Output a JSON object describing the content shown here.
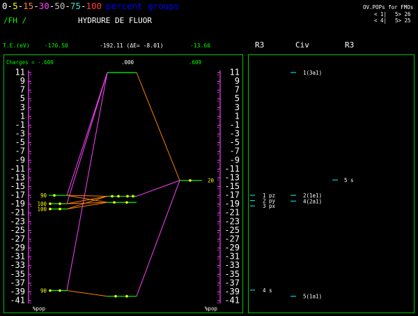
{
  "legend": {
    "scale": [
      {
        "text": "0",
        "color": "#ffffff"
      },
      {
        "text": "-",
        "color": "#ffffff"
      },
      {
        "text": "5",
        "color": "#ffff00"
      },
      {
        "text": "-",
        "color": "#ffffff"
      },
      {
        "text": "15",
        "color": "#ff8040"
      },
      {
        "text": "-",
        "color": "#ffffff"
      },
      {
        "text": "30",
        "color": "#ff40ff"
      },
      {
        "text": "-",
        "color": "#ffffff"
      },
      {
        "text": "50",
        "color": "#c0c0c0"
      },
      {
        "text": "-",
        "color": "#ffffff"
      },
      {
        "text": "75",
        "color": "#40e0d0"
      },
      {
        "text": "-",
        "color": "#ffffff"
      },
      {
        "text": "100",
        "color": "#ff4040"
      }
    ],
    "caption": "percent groups",
    "caption_color": "#0000ff"
  },
  "title": {
    "mol": "/FH /",
    "name": "HYDRURE DE FLUOR"
  },
  "ov_pops": {
    "heading": "OV.POPs for FMOs",
    "rows": [
      {
        "left": "<  1|",
        "right": "5> 26"
      },
      {
        "left": "<  4|",
        "right": "5> 25"
      }
    ]
  },
  "te": {
    "label": "T.E.(eV)",
    "left": "-170.50",
    "center": "-192.11  (ΔE= -8.01)",
    "right": "-13.60"
  },
  "charges": {
    "label": "Charges = -.609",
    "center": ".000",
    "right": ".609"
  },
  "axis": {
    "ticks": [
      "11",
      "9",
      "7",
      "5",
      "3",
      "1",
      "-1",
      "-3",
      "-5",
      "-7",
      "-9",
      "-11",
      "-13",
      "-15",
      "-17",
      "-19",
      "-21",
      "-23",
      "-25",
      "-27",
      "-29",
      "-31",
      "-33",
      "-35",
      "-37",
      "-39",
      "-41"
    ],
    "ymax": 11,
    "ymin": -41,
    "bottom_left": "%pop",
    "bottom_right": "%pop"
  },
  "colors": {
    "green": "#00ff00",
    "magenta": "#ff40ff",
    "orange": "#ff8000",
    "yellow": "#ffff00",
    "white": "#ffffff",
    "cyan": "#00ffff",
    "frame": "#00c000"
  },
  "mo_diagram": {
    "left_levels": [
      {
        "energy": -17.0,
        "label": "90"
      },
      {
        "energy": -18.9,
        "label": "100"
      },
      {
        "energy": -20.1,
        "label": "100"
      },
      {
        "energy": -38.7,
        "label": "90"
      }
    ],
    "center_levels": [
      {
        "energy": 11.0
      },
      {
        "energy": -17.2
      },
      {
        "energy": -18.6
      },
      {
        "energy": -40.0
      }
    ],
    "right_levels": [
      {
        "energy": -13.6,
        "label": "20"
      }
    ],
    "connections": [
      {
        "from": "L0",
        "to": "C0",
        "color": "#ff40ff"
      },
      {
        "from": "L1",
        "to": "C0",
        "color": "#ff40ff"
      },
      {
        "from": "L3",
        "to": "C0",
        "color": "#ff40ff"
      },
      {
        "from": "L0",
        "to": "C1",
        "color": "#ff8000"
      },
      {
        "from": "L1",
        "to": "C1",
        "color": "#ff8000"
      },
      {
        "from": "L2",
        "to": "C1",
        "color": "#ff8000"
      },
      {
        "from": "L0",
        "to": "C2",
        "color": "#ff8000"
      },
      {
        "from": "L1",
        "to": "C2",
        "color": "#ff8000"
      },
      {
        "from": "L2",
        "to": "C2",
        "color": "#ff8000"
      },
      {
        "from": "L3",
        "to": "C3",
        "color": "#ff8000"
      },
      {
        "from": "R0",
        "to": "C0",
        "color": "#ff8000"
      },
      {
        "from": "R0",
        "to": "C3",
        "color": "#ff40ff"
      },
      {
        "from": "R0",
        "to": "C1",
        "color": "#ff40ff"
      }
    ]
  },
  "panel": {
    "headers": [
      "R3",
      "Civ",
      "R3"
    ],
    "left": [
      {
        "energy": -17.0,
        "label": "1 pz"
      },
      {
        "energy": -18.2,
        "label": "2 py"
      },
      {
        "energy": -19.4,
        "label": "3 px"
      },
      {
        "energy": -38.6,
        "label": "4 s"
      }
    ],
    "middle": [
      {
        "energy": 11.0,
        "label": "1(3a1)"
      },
      {
        "energy": -17.0,
        "label": "2(1e1)"
      },
      {
        "energy": -18.3,
        "label": "4(2a1)"
      },
      {
        "energy": -40.0,
        "label": "5(1a1)"
      }
    ],
    "right": [
      {
        "energy": -13.5,
        "label": "5 s"
      }
    ]
  }
}
